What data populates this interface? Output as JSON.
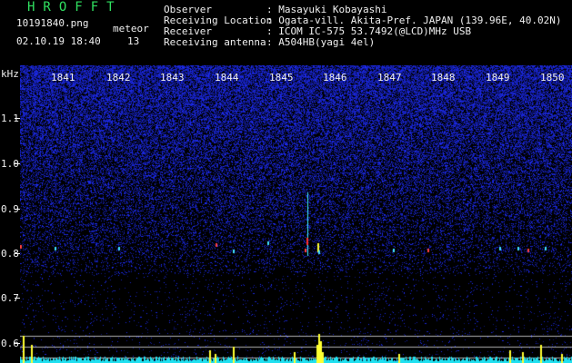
{
  "header": {
    "logo": "HROFFT",
    "filename": "10191840.png",
    "datetime": "02.10.19 18:40",
    "meteor_label": "meteor",
    "meteor_count": "13",
    "fields": [
      {
        "label": "Observer",
        "value": ": Masayuki Kobayashi"
      },
      {
        "label": "Receiving Location",
        "value": ": Ogata-vill. Akita-Pref. JAPAN (139.96E, 40.02N)"
      },
      {
        "label": "Receiver",
        "value": ": ICOM IC-575 53.7492(@LCD)MHz USB"
      },
      {
        "label": "Receiving antenna",
        "value": ": A504HB(yagi 4el)"
      }
    ]
  },
  "axes": {
    "y_unit": "kHz",
    "y_ticks": [
      "1.1",
      "1.0",
      "0.9",
      "0.8",
      "0.7",
      "0.6"
    ],
    "x_ticks": [
      "1841",
      "1842",
      "1843",
      "1844",
      "1845",
      "1846",
      "1847",
      "1848",
      "1849",
      "1850"
    ]
  },
  "colors": {
    "background": "#000000",
    "noise_blue": "#2030c0",
    "logo_green": "#30e060",
    "signal_cyan": "#20e0f0",
    "signal_yellow": "#ffff30",
    "signal_red": "#ff3030"
  }
}
